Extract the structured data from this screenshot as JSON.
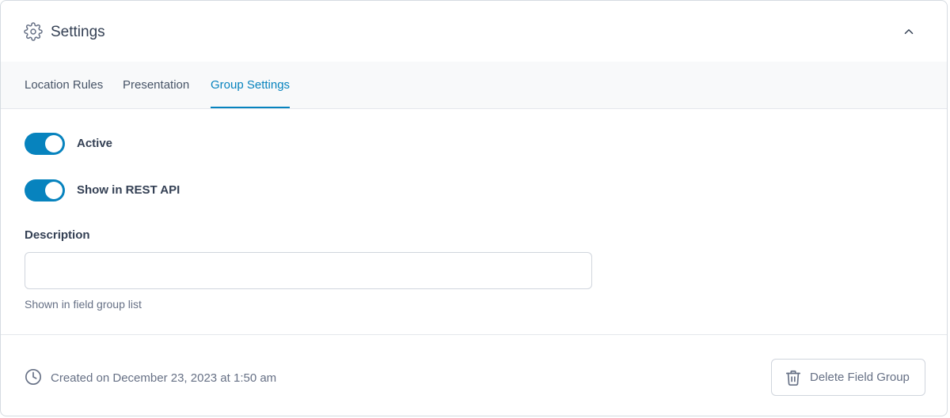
{
  "header": {
    "title": "Settings",
    "icon": "gear-icon",
    "collapse_icon": "chevron-up-icon"
  },
  "tabs": [
    {
      "label": "Location Rules",
      "active": false
    },
    {
      "label": "Presentation",
      "active": false
    },
    {
      "label": "Group Settings",
      "active": true
    }
  ],
  "toggles": [
    {
      "label": "Active",
      "on": true
    },
    {
      "label": "Show in REST API",
      "on": true
    }
  ],
  "description": {
    "label": "Description",
    "value": "",
    "hint": "Shown in field group list"
  },
  "footer": {
    "created_text": "Created on December 23, 2023 at 1:50 am",
    "delete_label": "Delete Field Group"
  },
  "colors": {
    "accent": "#0783be",
    "text": "#344054",
    "muted": "#667085",
    "border": "#d0d5dd"
  }
}
